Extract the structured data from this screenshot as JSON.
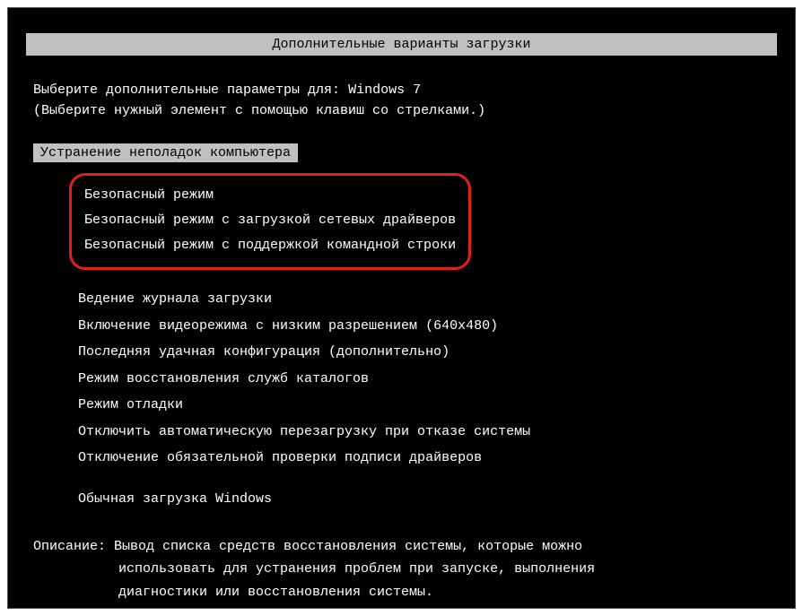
{
  "title": "Дополнительные варианты загрузки",
  "prompt": {
    "line1_prefix": "Выберите дополнительные параметры для: ",
    "os_name": "Windows 7",
    "line2": "(Выберите нужный элемент с помощью клавиш со стрелками.)"
  },
  "selected": {
    "label": "Устранение неполадок компьютера"
  },
  "highlighted_options": [
    "Безопасный режим",
    "Безопасный режим с загрузкой сетевых драйверов",
    "Безопасный режим с поддержкой командной строки"
  ],
  "options": [
    "Ведение журнала загрузки",
    "Включение видеорежима с низким разрешением (640x480)",
    "Последняя удачная конфигурация (дополнительно)",
    "Режим восстановления служб каталогов",
    "Режим отладки",
    "Отключить автоматическую перезагрузку при отказе системы",
    "Отключение обязательной проверки подписи драйверов"
  ],
  "normal_boot": "Обычная загрузка Windows",
  "description": {
    "label": "Описание:",
    "line1": "Вывод списка средств восстановления системы, которые можно",
    "line2": "использовать для устранения проблем при запуске, выполнения",
    "line3": "диагностики или восстановления системы."
  }
}
